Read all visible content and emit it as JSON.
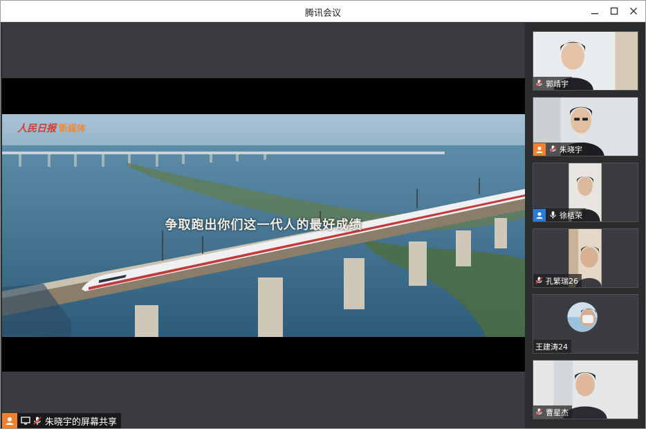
{
  "window": {
    "title": "腾讯会议"
  },
  "share": {
    "subtitle": "争取跑出你们这一代人的最好成绩",
    "logo_main": "人民日报",
    "logo_sub": "新媒体",
    "caption_top": "",
    "sharer_label": "朱晓宇的屏幕共享"
  },
  "participants": [
    {
      "name": "郭靖宇",
      "avatar": false,
      "mic": "muted"
    },
    {
      "name": "朱晓宇",
      "avatar": true,
      "avatar_color": "#f0812f",
      "mic": "muted"
    },
    {
      "name": "徐桔荣",
      "avatar": true,
      "avatar_color": "#2b79d8",
      "mic": "on"
    },
    {
      "name": "孔繁瑞26",
      "avatar": false,
      "mic": "muted"
    },
    {
      "name": "王建涛24",
      "avatar": false,
      "mic": "none"
    },
    {
      "name": "曹星杰",
      "avatar": false,
      "mic": "muted"
    }
  ],
  "colors": {
    "accent_orange": "#f0812f",
    "accent_blue": "#2b79d8",
    "background": "#2b2c2e"
  }
}
